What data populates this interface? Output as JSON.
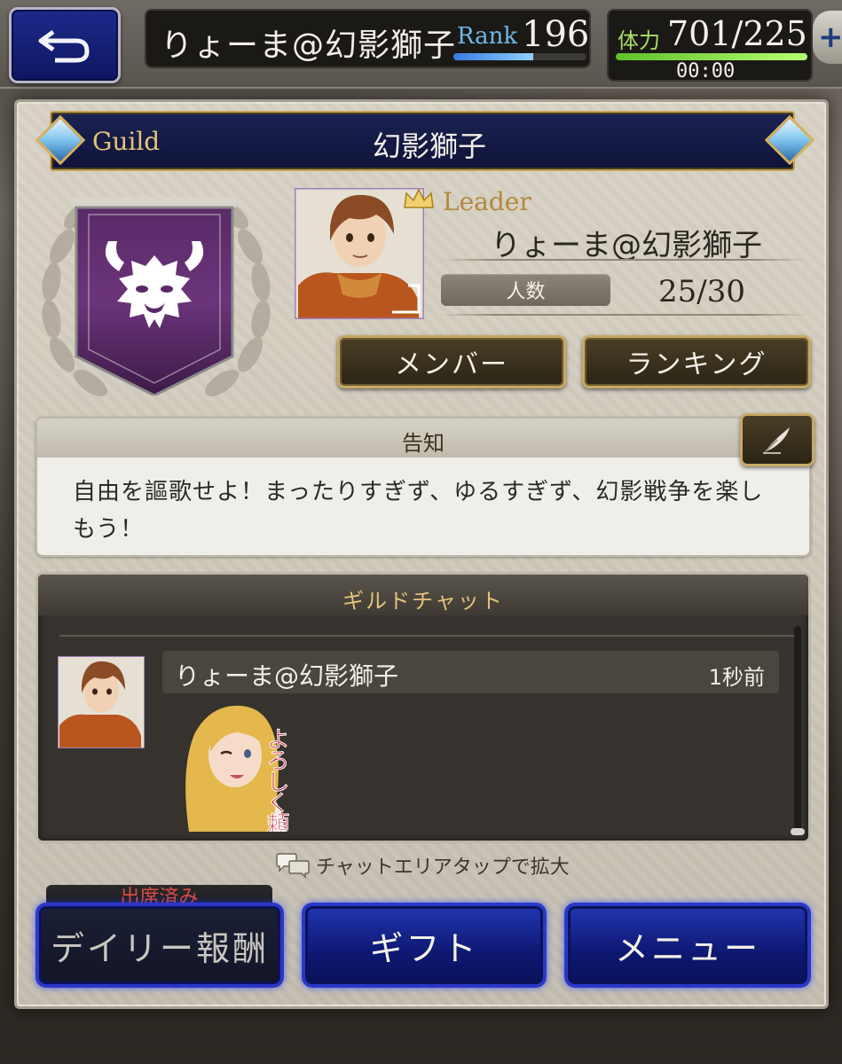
{
  "header": {
    "player_name": "りょーま@幻影獅子",
    "rank_label": "Rank",
    "rank_value": "196",
    "rank_progress": 0.6,
    "stamina_label": "体力",
    "stamina_value": "701/225",
    "stamina_progress": 1.0,
    "stamina_timer": "00:00",
    "plus_label": "+"
  },
  "guild": {
    "label": "Guild",
    "name": "幻影獅子"
  },
  "leader": {
    "label": "Leader",
    "name": "りょーま@幻影獅子",
    "members_label": "人数",
    "members_value": "25/30"
  },
  "buttons": {
    "members": "メンバー",
    "ranking": "ランキング",
    "daily_reward": "デイリー報酬",
    "gift": "ギフト",
    "menu": "メニュー"
  },
  "notice": {
    "title": "告知",
    "body": "自由を謳歌せよ！まったりすぎず、ゆるすぎず、幻影戦争を楽しもう！"
  },
  "chat": {
    "title": "ギルドチャット",
    "sender": "りょーま@幻影獅子",
    "time": "1秒前",
    "stamp_text": "よろしく頼む",
    "hint": "チャットエリアタップで拡大"
  },
  "daily": {
    "status": "出席済み"
  },
  "colors": {
    "navy_bar": "#1b2353",
    "gold_trim": "#c8a458",
    "blue_button": "#2136b0",
    "attended_red": "#e14a46"
  }
}
